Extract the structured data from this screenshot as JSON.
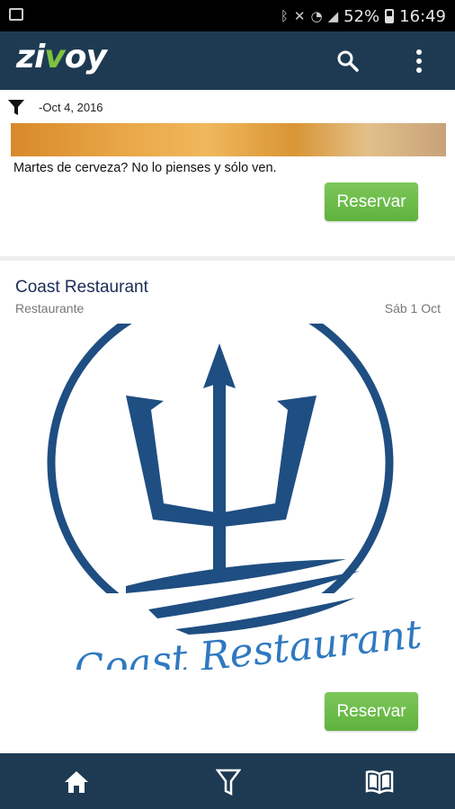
{
  "status_bar": {
    "battery": "52%",
    "time": "16:49",
    "icons": [
      "screenshot-icon",
      "bluetooth-icon",
      "mute-icon",
      "wifi-icon",
      "signal-icon",
      "battery-icon"
    ]
  },
  "app_bar": {
    "logo": {
      "part1": "zi",
      "part2": "v",
      "part3": "oy"
    },
    "icons": [
      "search-icon",
      "more-vert-icon"
    ],
    "colors": {
      "bar": "#1e3a52",
      "logo_accent": "#7ec142"
    }
  },
  "filter": {
    "date_label": "-Oct 4, 2016",
    "icon": "filter-icon"
  },
  "cards": [
    {
      "description": "Martes de cerveza? No lo pienses y sólo ven.",
      "button_label": "Reservar"
    },
    {
      "title": "Coast Restaurant",
      "category": "Restaurante",
      "date": "Sáb 1 Oct",
      "logo_text": "Coast Restaurant",
      "button_label": "Reservar"
    }
  ],
  "bottom_nav": {
    "icons": [
      "home-icon",
      "filter-icon",
      "book-icon"
    ]
  },
  "colors": {
    "button": "#66b845",
    "title": "#1b2c57",
    "logo_blue": "#1f4e82"
  }
}
